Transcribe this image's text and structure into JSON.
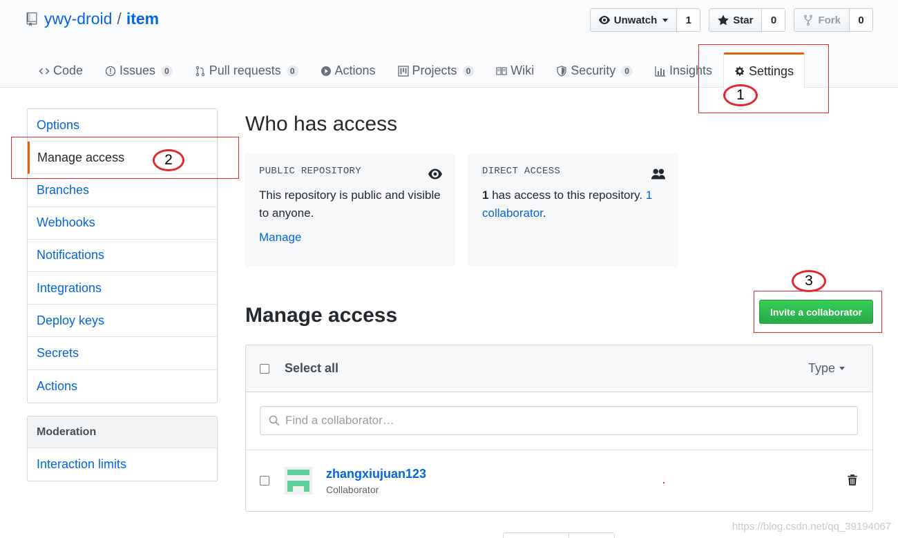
{
  "repo": {
    "owner": "ywy-droid",
    "separator": "/",
    "name": "item"
  },
  "actions": {
    "watch": {
      "label": "Unwatch",
      "count": "1"
    },
    "star": {
      "label": "Star",
      "count": "0"
    },
    "fork": {
      "label": "Fork",
      "count": "0"
    }
  },
  "tabs": [
    {
      "label": "Code",
      "icon": "code-icon"
    },
    {
      "label": "Issues",
      "counter": "0",
      "icon": "issue-icon"
    },
    {
      "label": "Pull requests",
      "counter": "0",
      "icon": "pull-request-icon"
    },
    {
      "label": "Actions",
      "icon": "play-icon"
    },
    {
      "label": "Projects",
      "counter": "0",
      "icon": "project-icon"
    },
    {
      "label": "Wiki",
      "icon": "book-icon"
    },
    {
      "label": "Security",
      "counter": "0",
      "icon": "shield-icon"
    },
    {
      "label": "Insights",
      "icon": "graph-icon"
    },
    {
      "label": "Settings",
      "icon": "gear-icon",
      "selected": true
    }
  ],
  "sidebar": {
    "items": [
      "Options",
      "Manage access",
      "Branches",
      "Webhooks",
      "Notifications",
      "Integrations",
      "Deploy keys",
      "Secrets",
      "Actions"
    ],
    "selected": "Manage access",
    "moderation_heading": "Moderation",
    "moderation_items": [
      "Interaction limits"
    ]
  },
  "who_has_access": {
    "title": "Who has access",
    "public": {
      "label": "PUBLIC REPOSITORY",
      "text": "This repository is public and visible to anyone.",
      "link": "Manage"
    },
    "direct": {
      "label": "DIRECT ACCESS",
      "count": "1",
      "text_mid": " has access to this repository. ",
      "link": "1 collaborator",
      "end": "."
    }
  },
  "manage_access": {
    "title": "Manage access",
    "invite_button": "Invite a collaborator",
    "select_all": "Select all",
    "type_filter": "Type",
    "search_placeholder": "Find a collaborator…",
    "members": [
      {
        "name": "zhangxiujuan123",
        "role": "Collaborator",
        "avatar_color": "#5fcf9b"
      }
    ]
  },
  "annotations": [
    "1",
    "2",
    "3"
  ],
  "watermark": "https://blog.csdn.net/qq_39194067",
  "colors": {
    "accent_tab": "#e36209",
    "link": "#0366d6",
    "invite_green": "#28a745",
    "annotation_red": "#e0282e"
  }
}
